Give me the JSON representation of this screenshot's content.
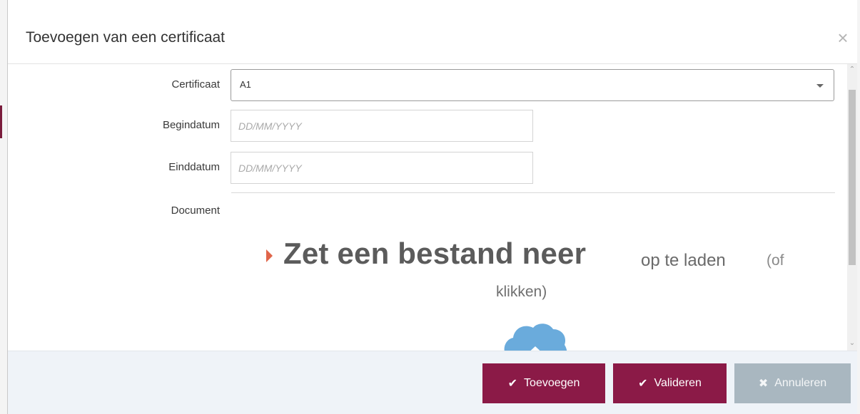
{
  "modal": {
    "title": "Toevoegen van een certificaat",
    "close_glyph": "×"
  },
  "form": {
    "certificate": {
      "label": "Certificaat",
      "value": "A1"
    },
    "start_date": {
      "label": "Begindatum",
      "placeholder": "DD/MM/YYYY"
    },
    "end_date": {
      "label": "Einddatum",
      "placeholder": "DD/MM/YYYY"
    },
    "document": {
      "label": "Document"
    }
  },
  "dropzone": {
    "main": "Zet een bestand neer",
    "rest": "op te laden",
    "of": "(of",
    "line2": "klikken)",
    "icon": "cloud-upload-icon"
  },
  "footer": {
    "add_label": "Toevoegen",
    "add_icon": "check-icon",
    "validate_label": "Valideren",
    "validate_icon": "check-icon",
    "cancel_label": "Annuleren",
    "cancel_icon": "times-icon"
  },
  "colors": {
    "primary": "#8b1a47",
    "secondary": "#a9b7c0",
    "footer_bg": "#eff3f8",
    "dropzone_arrow": "#e0654a",
    "cloud": "#6aabdc"
  }
}
